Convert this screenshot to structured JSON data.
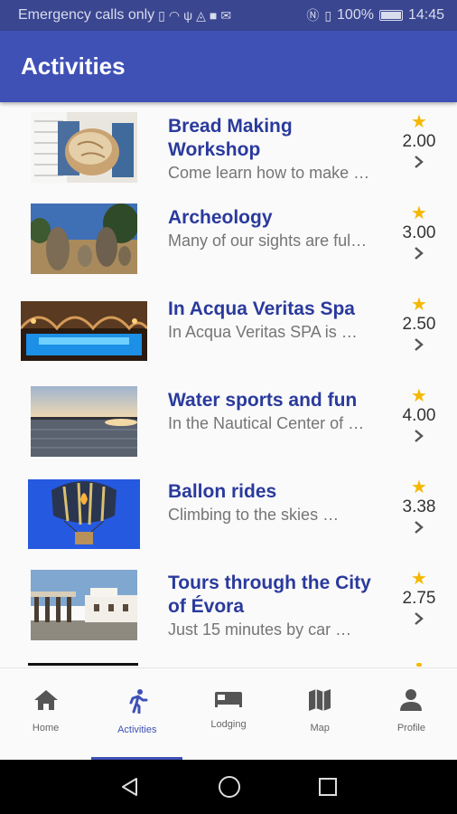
{
  "status_bar": {
    "carrier": "Emergency calls only",
    "battery": "100%",
    "time": "14:45"
  },
  "app_bar": {
    "title": "Activities"
  },
  "activities": [
    {
      "title": "Bread Making Workshop",
      "description": "Come learn how to make …",
      "rating": "2.00",
      "image": "bread-photo"
    },
    {
      "title": "Archeology",
      "description": "Many of our sights are ful…",
      "rating": "3.00",
      "image": "megaliths-photo"
    },
    {
      "title": "In Acqua Veritas Spa",
      "description": "In Acqua Veritas SPA is …",
      "rating": "2.50",
      "image": "spa-photo"
    },
    {
      "title": "Water sports and fun",
      "description": "In the Nautical Center of …",
      "rating": "4.00",
      "image": "lake-photo"
    },
    {
      "title": "Ballon rides",
      "description": "Climbing to the skies …",
      "rating": "3.38",
      "image": "balloon-photo"
    },
    {
      "title": "Tours through the City of Évora",
      "description": "Just 15 minutes by car …",
      "rating": "2.75",
      "image": "evora-photo"
    }
  ],
  "bottom_nav": [
    {
      "label": "Home",
      "icon": "home-icon"
    },
    {
      "label": "Activities",
      "icon": "run-icon",
      "active": true
    },
    {
      "label": "Lodging",
      "icon": "bed-icon"
    },
    {
      "label": "Map",
      "icon": "map-icon"
    },
    {
      "label": "Profile",
      "icon": "person-icon"
    }
  ],
  "colors": {
    "primary": "#3f51b5",
    "title_text": "#2a3a9c",
    "star": "#f5b800"
  }
}
